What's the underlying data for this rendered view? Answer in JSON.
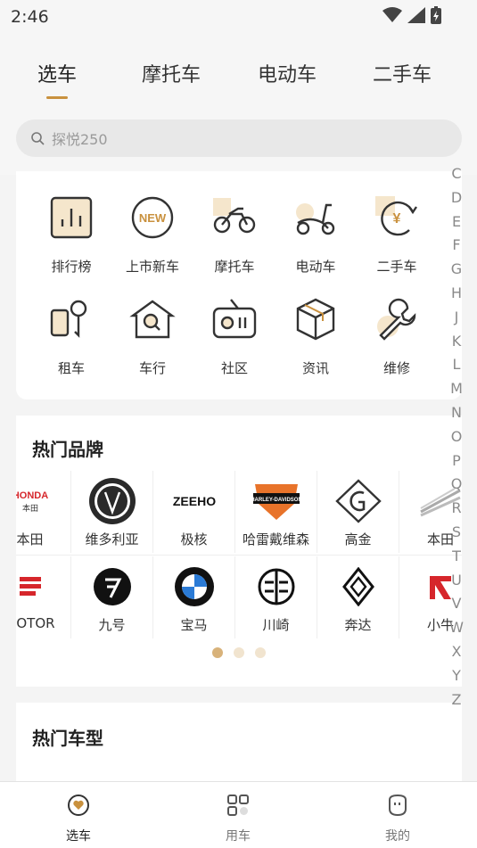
{
  "status": {
    "time": "2:46"
  },
  "tabs": [
    {
      "label": "选车"
    },
    {
      "label": "摩托车"
    },
    {
      "label": "电动车"
    },
    {
      "label": "二手车"
    }
  ],
  "search": {
    "placeholder": "探悦250"
  },
  "quick_grid": [
    {
      "label": "排行榜",
      "icon": "ranking-icon"
    },
    {
      "label": "上市新车",
      "icon": "new-icon"
    },
    {
      "label": "摩托车",
      "icon": "motorcycle-icon"
    },
    {
      "label": "电动车",
      "icon": "scooter-icon"
    },
    {
      "label": "二手车",
      "icon": "used-car-icon"
    },
    {
      "label": "租车",
      "icon": "rental-key-icon"
    },
    {
      "label": "车行",
      "icon": "dealer-icon"
    },
    {
      "label": "社区",
      "icon": "community-radio-icon"
    },
    {
      "label": "资讯",
      "icon": "news-box-icon"
    },
    {
      "label": "维修",
      "icon": "repair-wrench-icon"
    }
  ],
  "hot_brands": {
    "title": "热门品牌",
    "row1": [
      "本田",
      "维多利亚",
      "极核",
      "哈雷戴维森",
      "高金",
      "本田"
    ],
    "row2": [
      "MOTOR",
      "九号",
      "宝马",
      "川崎",
      "奔达",
      "小牛"
    ],
    "pages": 3,
    "active_page": 0
  },
  "hot_models": {
    "title": "热门车型"
  },
  "alphabet": [
    "C",
    "D",
    "E",
    "F",
    "G",
    "H",
    "J",
    "K",
    "L",
    "M",
    "N",
    "O",
    "P",
    "Q",
    "R",
    "S",
    "T",
    "U",
    "V",
    "W",
    "X",
    "Y",
    "Z"
  ],
  "bottom_nav": [
    {
      "label": "选车"
    },
    {
      "label": "用车"
    },
    {
      "label": "我的"
    }
  ],
  "colors": {
    "accent": "#c9913e",
    "dot_active": "#d8b27a"
  }
}
